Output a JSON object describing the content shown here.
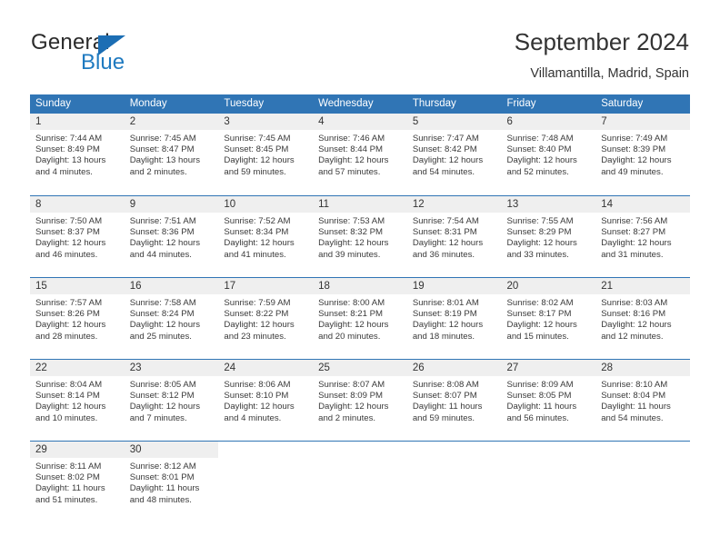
{
  "logo": {
    "word_one": "General",
    "word_two": "Blue",
    "accent_color": "#1c6eb4"
  },
  "header": {
    "title": "September 2024",
    "subtitle": "Villamantilla, Madrid, Spain"
  },
  "calendar": {
    "header_bg": "#3075b5",
    "daynumber_bg": "#efefef",
    "weekdays": [
      "Sunday",
      "Monday",
      "Tuesday",
      "Wednesday",
      "Thursday",
      "Friday",
      "Saturday"
    ],
    "weeks": [
      [
        {
          "day": "1",
          "sunrise": "Sunrise: 7:44 AM",
          "sunset": "Sunset: 8:49 PM",
          "daylight_line1": "Daylight: 13 hours",
          "daylight_line2": "and 4 minutes."
        },
        {
          "day": "2",
          "sunrise": "Sunrise: 7:45 AM",
          "sunset": "Sunset: 8:47 PM",
          "daylight_line1": "Daylight: 13 hours",
          "daylight_line2": "and 2 minutes."
        },
        {
          "day": "3",
          "sunrise": "Sunrise: 7:45 AM",
          "sunset": "Sunset: 8:45 PM",
          "daylight_line1": "Daylight: 12 hours",
          "daylight_line2": "and 59 minutes."
        },
        {
          "day": "4",
          "sunrise": "Sunrise: 7:46 AM",
          "sunset": "Sunset: 8:44 PM",
          "daylight_line1": "Daylight: 12 hours",
          "daylight_line2": "and 57 minutes."
        },
        {
          "day": "5",
          "sunrise": "Sunrise: 7:47 AM",
          "sunset": "Sunset: 8:42 PM",
          "daylight_line1": "Daylight: 12 hours",
          "daylight_line2": "and 54 minutes."
        },
        {
          "day": "6",
          "sunrise": "Sunrise: 7:48 AM",
          "sunset": "Sunset: 8:40 PM",
          "daylight_line1": "Daylight: 12 hours",
          "daylight_line2": "and 52 minutes."
        },
        {
          "day": "7",
          "sunrise": "Sunrise: 7:49 AM",
          "sunset": "Sunset: 8:39 PM",
          "daylight_line1": "Daylight: 12 hours",
          "daylight_line2": "and 49 minutes."
        }
      ],
      [
        {
          "day": "8",
          "sunrise": "Sunrise: 7:50 AM",
          "sunset": "Sunset: 8:37 PM",
          "daylight_line1": "Daylight: 12 hours",
          "daylight_line2": "and 46 minutes."
        },
        {
          "day": "9",
          "sunrise": "Sunrise: 7:51 AM",
          "sunset": "Sunset: 8:36 PM",
          "daylight_line1": "Daylight: 12 hours",
          "daylight_line2": "and 44 minutes."
        },
        {
          "day": "10",
          "sunrise": "Sunrise: 7:52 AM",
          "sunset": "Sunset: 8:34 PM",
          "daylight_line1": "Daylight: 12 hours",
          "daylight_line2": "and 41 minutes."
        },
        {
          "day": "11",
          "sunrise": "Sunrise: 7:53 AM",
          "sunset": "Sunset: 8:32 PM",
          "daylight_line1": "Daylight: 12 hours",
          "daylight_line2": "and 39 minutes."
        },
        {
          "day": "12",
          "sunrise": "Sunrise: 7:54 AM",
          "sunset": "Sunset: 8:31 PM",
          "daylight_line1": "Daylight: 12 hours",
          "daylight_line2": "and 36 minutes."
        },
        {
          "day": "13",
          "sunrise": "Sunrise: 7:55 AM",
          "sunset": "Sunset: 8:29 PM",
          "daylight_line1": "Daylight: 12 hours",
          "daylight_line2": "and 33 minutes."
        },
        {
          "day": "14",
          "sunrise": "Sunrise: 7:56 AM",
          "sunset": "Sunset: 8:27 PM",
          "daylight_line1": "Daylight: 12 hours",
          "daylight_line2": "and 31 minutes."
        }
      ],
      [
        {
          "day": "15",
          "sunrise": "Sunrise: 7:57 AM",
          "sunset": "Sunset: 8:26 PM",
          "daylight_line1": "Daylight: 12 hours",
          "daylight_line2": "and 28 minutes."
        },
        {
          "day": "16",
          "sunrise": "Sunrise: 7:58 AM",
          "sunset": "Sunset: 8:24 PM",
          "daylight_line1": "Daylight: 12 hours",
          "daylight_line2": "and 25 minutes."
        },
        {
          "day": "17",
          "sunrise": "Sunrise: 7:59 AM",
          "sunset": "Sunset: 8:22 PM",
          "daylight_line1": "Daylight: 12 hours",
          "daylight_line2": "and 23 minutes."
        },
        {
          "day": "18",
          "sunrise": "Sunrise: 8:00 AM",
          "sunset": "Sunset: 8:21 PM",
          "daylight_line1": "Daylight: 12 hours",
          "daylight_line2": "and 20 minutes."
        },
        {
          "day": "19",
          "sunrise": "Sunrise: 8:01 AM",
          "sunset": "Sunset: 8:19 PM",
          "daylight_line1": "Daylight: 12 hours",
          "daylight_line2": "and 18 minutes."
        },
        {
          "day": "20",
          "sunrise": "Sunrise: 8:02 AM",
          "sunset": "Sunset: 8:17 PM",
          "daylight_line1": "Daylight: 12 hours",
          "daylight_line2": "and 15 minutes."
        },
        {
          "day": "21",
          "sunrise": "Sunrise: 8:03 AM",
          "sunset": "Sunset: 8:16 PM",
          "daylight_line1": "Daylight: 12 hours",
          "daylight_line2": "and 12 minutes."
        }
      ],
      [
        {
          "day": "22",
          "sunrise": "Sunrise: 8:04 AM",
          "sunset": "Sunset: 8:14 PM",
          "daylight_line1": "Daylight: 12 hours",
          "daylight_line2": "and 10 minutes."
        },
        {
          "day": "23",
          "sunrise": "Sunrise: 8:05 AM",
          "sunset": "Sunset: 8:12 PM",
          "daylight_line1": "Daylight: 12 hours",
          "daylight_line2": "and 7 minutes."
        },
        {
          "day": "24",
          "sunrise": "Sunrise: 8:06 AM",
          "sunset": "Sunset: 8:10 PM",
          "daylight_line1": "Daylight: 12 hours",
          "daylight_line2": "and 4 minutes."
        },
        {
          "day": "25",
          "sunrise": "Sunrise: 8:07 AM",
          "sunset": "Sunset: 8:09 PM",
          "daylight_line1": "Daylight: 12 hours",
          "daylight_line2": "and 2 minutes."
        },
        {
          "day": "26",
          "sunrise": "Sunrise: 8:08 AM",
          "sunset": "Sunset: 8:07 PM",
          "daylight_line1": "Daylight: 11 hours",
          "daylight_line2": "and 59 minutes."
        },
        {
          "day": "27",
          "sunrise": "Sunrise: 8:09 AM",
          "sunset": "Sunset: 8:05 PM",
          "daylight_line1": "Daylight: 11 hours",
          "daylight_line2": "and 56 minutes."
        },
        {
          "day": "28",
          "sunrise": "Sunrise: 8:10 AM",
          "sunset": "Sunset: 8:04 PM",
          "daylight_line1": "Daylight: 11 hours",
          "daylight_line2": "and 54 minutes."
        }
      ],
      [
        {
          "day": "29",
          "sunrise": "Sunrise: 8:11 AM",
          "sunset": "Sunset: 8:02 PM",
          "daylight_line1": "Daylight: 11 hours",
          "daylight_line2": "and 51 minutes."
        },
        {
          "day": "30",
          "sunrise": "Sunrise: 8:12 AM",
          "sunset": "Sunset: 8:01 PM",
          "daylight_line1": "Daylight: 11 hours",
          "daylight_line2": "and 48 minutes."
        },
        {
          "day": "",
          "sunrise": "",
          "sunset": "",
          "daylight_line1": "",
          "daylight_line2": ""
        },
        {
          "day": "",
          "sunrise": "",
          "sunset": "",
          "daylight_line1": "",
          "daylight_line2": ""
        },
        {
          "day": "",
          "sunrise": "",
          "sunset": "",
          "daylight_line1": "",
          "daylight_line2": ""
        },
        {
          "day": "",
          "sunrise": "",
          "sunset": "",
          "daylight_line1": "",
          "daylight_line2": ""
        },
        {
          "day": "",
          "sunrise": "",
          "sunset": "",
          "daylight_line1": "",
          "daylight_line2": ""
        }
      ]
    ]
  }
}
